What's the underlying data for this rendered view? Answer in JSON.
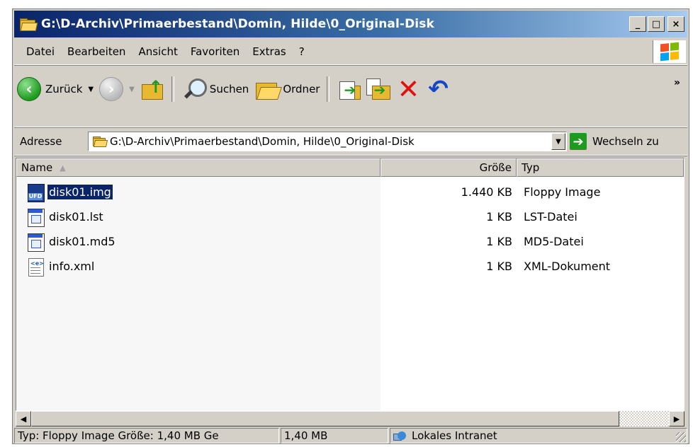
{
  "window": {
    "title": "G:\\D-Archiv\\Primaerbestand\\Domin, Hilde\\0_Original-Disk",
    "buttons": {
      "minimize": "_",
      "maximize": "□",
      "close": "×"
    }
  },
  "menu": [
    "Datei",
    "Bearbeiten",
    "Ansicht",
    "Favoriten",
    "Extras",
    "?"
  ],
  "toolbar": {
    "back_label": "Zurück",
    "search_label": "Suchen",
    "folders_label": "Ordner",
    "overflow": "»"
  },
  "address": {
    "label": "Adresse",
    "value": "G:\\D-Archiv\\Primaerbestand\\Domin, Hilde\\0_Original-Disk",
    "go_label": "Wechseln zu"
  },
  "columns": {
    "name": "Name",
    "size": "Größe",
    "type": "Typ"
  },
  "files": [
    {
      "name": "disk01.img",
      "size": "1.440 KB",
      "type": "Floppy Image",
      "icon": "floppy-image-icon",
      "selected": true
    },
    {
      "name": "disk01.lst",
      "size": "1 KB",
      "type": "LST-Datei",
      "icon": "generic-file-icon",
      "selected": false
    },
    {
      "name": "disk01.md5",
      "size": "1 KB",
      "type": "MD5-Datei",
      "icon": "generic-file-icon",
      "selected": false
    },
    {
      "name": "info.xml",
      "size": "1 KB",
      "type": "XML-Dokument",
      "icon": "xml-document-icon",
      "selected": false
    }
  ],
  "status": {
    "info": "Typ: Floppy Image Größe: 1,40 MB Ge",
    "size": "1,40 MB",
    "zone": "Lokales Intranet"
  },
  "colors": {
    "title_start": "#0a246a",
    "title_end": "#a6caf0",
    "selection": "#0a246a",
    "face": "#d4d0c8"
  }
}
